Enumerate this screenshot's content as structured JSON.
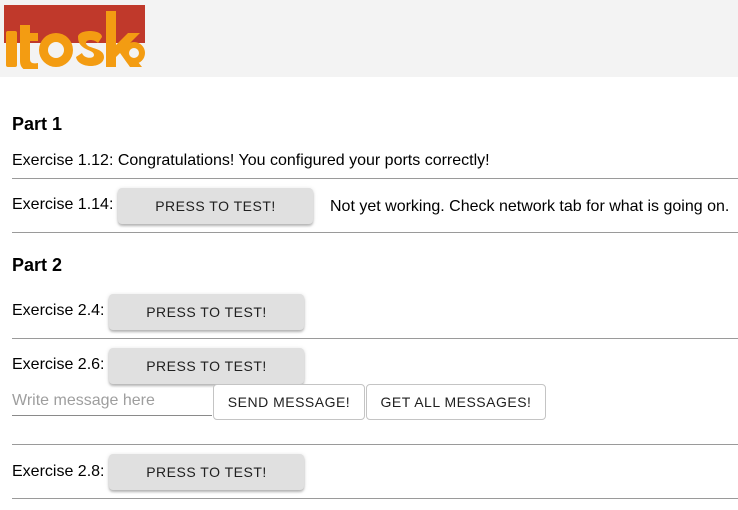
{
  "brand": {
    "logo_text": "itoska",
    "colors": {
      "red": "#c0392b",
      "orange": "#f39c12",
      "header_bg": "#f3f3f3"
    }
  },
  "part1": {
    "title": "Part 1",
    "exercise_1_12": {
      "text": "Exercise 1.12: Congratulations! You configured your ports correctly!"
    },
    "exercise_1_14": {
      "label": "Exercise 1.14:",
      "button": "PRESS TO TEST!",
      "status": "Not yet working. Check network tab for what is going on."
    }
  },
  "part2": {
    "title": "Part 2",
    "exercise_2_4": {
      "label": "Exercise 2.4:",
      "button": "PRESS TO TEST!"
    },
    "exercise_2_6": {
      "label": "Exercise 2.6:",
      "button": "PRESS TO TEST!",
      "message_input": {
        "value": "",
        "placeholder": "Write message here"
      },
      "send_button": "SEND MESSAGE!",
      "get_all_button": "GET ALL MESSAGES!"
    },
    "exercise_2_8": {
      "label": "Exercise 2.8:",
      "button": "PRESS TO TEST!"
    }
  }
}
